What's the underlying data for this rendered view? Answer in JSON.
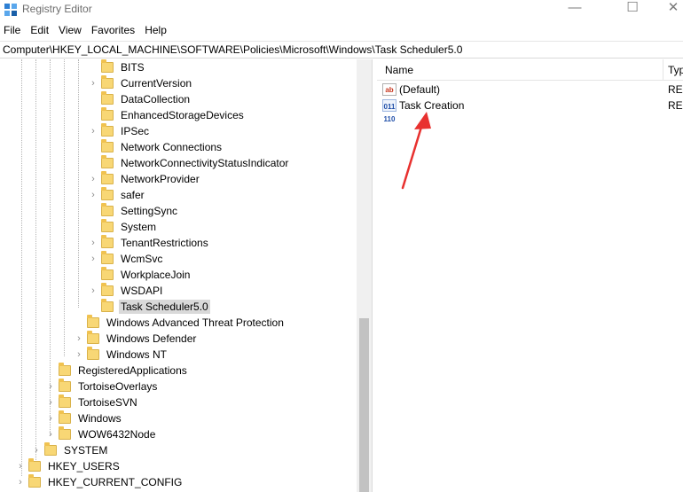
{
  "window": {
    "title": "Registry Editor",
    "min_glyph": "—",
    "max_glyph": "☐",
    "close_glyph": "✕"
  },
  "menu": [
    "File",
    "Edit",
    "View",
    "Favorites",
    "Help"
  ],
  "address": "Computer\\HKEY_LOCAL_MACHINE\\SOFTWARE\\Policies\\Microsoft\\Windows\\Task Scheduler5.0",
  "tree": {
    "items": [
      {
        "label": "BITS",
        "expandable": false,
        "level": 4
      },
      {
        "label": "CurrentVersion",
        "expandable": true,
        "level": 4
      },
      {
        "label": "DataCollection",
        "expandable": false,
        "level": 4
      },
      {
        "label": "EnhancedStorageDevices",
        "expandable": false,
        "level": 4
      },
      {
        "label": "IPSec",
        "expandable": true,
        "level": 4
      },
      {
        "label": "Network Connections",
        "expandable": false,
        "level": 4
      },
      {
        "label": "NetworkConnectivityStatusIndicator",
        "expandable": false,
        "level": 4
      },
      {
        "label": "NetworkProvider",
        "expandable": true,
        "level": 4
      },
      {
        "label": "safer",
        "expandable": true,
        "level": 4
      },
      {
        "label": "SettingSync",
        "expandable": false,
        "level": 4
      },
      {
        "label": "System",
        "expandable": false,
        "level": 4
      },
      {
        "label": "TenantRestrictions",
        "expandable": true,
        "level": 4
      },
      {
        "label": "WcmSvc",
        "expandable": true,
        "level": 4
      },
      {
        "label": "WorkplaceJoin",
        "expandable": false,
        "level": 4
      },
      {
        "label": "WSDAPI",
        "expandable": true,
        "level": 4
      },
      {
        "label": "Task Scheduler5.0",
        "expandable": false,
        "level": 4,
        "selected": true
      },
      {
        "label": "Windows Advanced Threat Protection",
        "expandable": false,
        "level": 3
      },
      {
        "label": "Windows Defender",
        "expandable": true,
        "level": 3
      },
      {
        "label": "Windows NT",
        "expandable": true,
        "level": 3
      },
      {
        "label": "RegisteredApplications",
        "expandable": false,
        "level": 2
      },
      {
        "label": "TortoiseOverlays",
        "expandable": true,
        "level": 2
      },
      {
        "label": "TortoiseSVN",
        "expandable": true,
        "level": 2
      },
      {
        "label": "Windows",
        "expandable": true,
        "level": 2
      },
      {
        "label": "WOW6432Node",
        "expandable": true,
        "level": 2
      },
      {
        "label": "SYSTEM",
        "expandable": true,
        "level": 1
      },
      {
        "label": "HKEY_USERS",
        "expandable": true,
        "level": 0
      },
      {
        "label": "HKEY_CURRENT_CONFIG",
        "expandable": true,
        "level": 0
      }
    ]
  },
  "list": {
    "columns": {
      "name": "Name",
      "type": "Typ"
    },
    "rows": [
      {
        "icon": "ab",
        "name": "(Default)",
        "type": "REG"
      },
      {
        "icon": "bin",
        "name": "Task Creation",
        "type": "REG"
      }
    ]
  },
  "annotation": {
    "color": "#e8312f"
  }
}
